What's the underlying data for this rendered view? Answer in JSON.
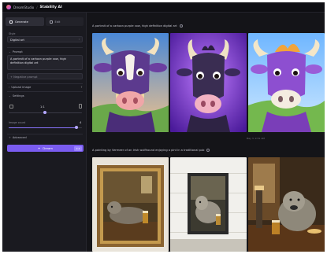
{
  "header": {
    "brand": "DreamStudio",
    "separator": "/",
    "app_name": "Stability AI"
  },
  "sidebar": {
    "tabs": [
      {
        "label": "Generate",
        "active": true,
        "icon": "sparkle-icon"
      },
      {
        "label": "Edit",
        "active": false,
        "icon": "edit-icon"
      }
    ],
    "style": {
      "label": "Style",
      "value": "Digital art"
    },
    "prompt": {
      "label": "Prompt",
      "value": "A portrait of a cartoon purple cow, high definition digital art"
    },
    "negative_prompt": {
      "label": "Negative prompt"
    },
    "upload_image": {
      "label": "Upload image"
    },
    "settings": {
      "label": "Settings",
      "ratio_value": "1:1",
      "image_count_label": "Image count",
      "image_count_value": "4",
      "image_count_fraction": 0.92
    },
    "advanced": {
      "label": "Advanced"
    },
    "dream_button": {
      "label": "Dream",
      "badge": "2.4"
    }
  },
  "main": {
    "batches": [
      {
        "prompt": "A portrait of a cartoon purple cow, high definition digital art",
        "meta": "May 3, 9:51 AM"
      },
      {
        "prompt": "A painting by Vermeer of an Irish wolfhound enjoying a pint in a traditional pub",
        "meta": ""
      }
    ]
  },
  "colors": {
    "accent": "#7a5cf0",
    "background": "#141418",
    "sidebar": "#1a1a20"
  }
}
